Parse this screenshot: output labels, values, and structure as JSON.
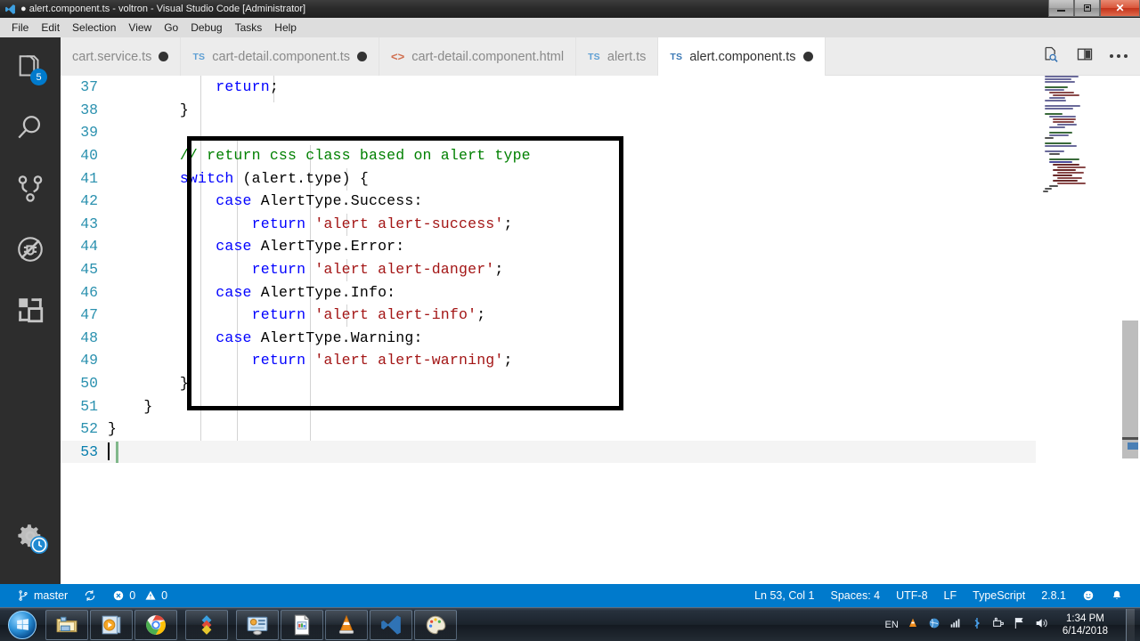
{
  "window": {
    "title": "● alert.component.ts - voltron - Visual Studio Code [Administrator]",
    "icon": "vscode-icon",
    "buttons": {
      "minimize": "minimize-button",
      "restore": "restore-button",
      "close": "close-button"
    }
  },
  "menubar": {
    "items": [
      "File",
      "Edit",
      "Selection",
      "View",
      "Go",
      "Debug",
      "Tasks",
      "Help"
    ]
  },
  "activitybar": {
    "items": [
      {
        "name": "explorer",
        "icon": "files-icon",
        "badge": "5"
      },
      {
        "name": "search",
        "icon": "search-icon",
        "badge": ""
      },
      {
        "name": "source-control",
        "icon": "source-control-icon",
        "badge": ""
      },
      {
        "name": "debug",
        "icon": "debug-no-icon",
        "badge": ""
      },
      {
        "name": "extensions",
        "icon": "extensions-icon",
        "badge": ""
      }
    ],
    "bottom": {
      "name": "manage",
      "icon": "gear-icon",
      "badge_icon": "clock-icon"
    }
  },
  "tabs": [
    {
      "label": "cart.service.ts",
      "icon": "",
      "dirty": true,
      "active": false
    },
    {
      "label": "cart-detail.component.ts",
      "icon": "TS",
      "dirty": true,
      "active": false
    },
    {
      "label": "cart-detail.component.html",
      "icon": "<>",
      "dirty": false,
      "active": false
    },
    {
      "label": "alert.ts",
      "icon": "TS",
      "dirty": false,
      "active": false
    },
    {
      "label": "alert.component.ts",
      "icon": "TS",
      "dirty": true,
      "active": true
    }
  ],
  "tab_actions": [
    {
      "name": "open-preview-icon"
    },
    {
      "name": "split-editor-icon"
    },
    {
      "name": "more-actions-icon"
    }
  ],
  "editor": {
    "first_line": 37,
    "lines": [
      {
        "num": 37,
        "tokens": [
          {
            "t": "            ",
            "c": ""
          },
          {
            "t": "return",
            "c": "ctl"
          },
          {
            "t": ";",
            "c": ""
          }
        ]
      },
      {
        "num": 38,
        "tokens": [
          {
            "t": "        }",
            "c": ""
          }
        ]
      },
      {
        "num": 39,
        "tokens": [
          {
            "t": "",
            "c": ""
          }
        ]
      },
      {
        "num": 40,
        "tokens": [
          {
            "t": "        // return css class based on alert type",
            "c": "cm"
          }
        ]
      },
      {
        "num": 41,
        "tokens": [
          {
            "t": "        ",
            "c": ""
          },
          {
            "t": "switch",
            "c": "ctl"
          },
          {
            "t": " (alert.type) {",
            "c": ""
          }
        ]
      },
      {
        "num": 42,
        "tokens": [
          {
            "t": "            ",
            "c": ""
          },
          {
            "t": "case",
            "c": "ctl"
          },
          {
            "t": " AlertType.Success:",
            "c": ""
          }
        ]
      },
      {
        "num": 43,
        "tokens": [
          {
            "t": "                ",
            "c": ""
          },
          {
            "t": "return",
            "c": "ctl"
          },
          {
            "t": " ",
            "c": ""
          },
          {
            "t": "'alert alert-success'",
            "c": "str"
          },
          {
            "t": ";",
            "c": ""
          }
        ]
      },
      {
        "num": 44,
        "tokens": [
          {
            "t": "            ",
            "c": ""
          },
          {
            "t": "case",
            "c": "ctl"
          },
          {
            "t": " AlertType.Error:",
            "c": ""
          }
        ]
      },
      {
        "num": 45,
        "tokens": [
          {
            "t": "                ",
            "c": ""
          },
          {
            "t": "return",
            "c": "ctl"
          },
          {
            "t": " ",
            "c": ""
          },
          {
            "t": "'alert alert-danger'",
            "c": "str"
          },
          {
            "t": ";",
            "c": ""
          }
        ]
      },
      {
        "num": 46,
        "tokens": [
          {
            "t": "            ",
            "c": ""
          },
          {
            "t": "case",
            "c": "ctl"
          },
          {
            "t": " AlertType.Info:",
            "c": ""
          }
        ]
      },
      {
        "num": 47,
        "tokens": [
          {
            "t": "                ",
            "c": ""
          },
          {
            "t": "return",
            "c": "ctl"
          },
          {
            "t": " ",
            "c": ""
          },
          {
            "t": "'alert alert-info'",
            "c": "str"
          },
          {
            "t": ";",
            "c": ""
          }
        ]
      },
      {
        "num": 48,
        "tokens": [
          {
            "t": "            ",
            "c": ""
          },
          {
            "t": "case",
            "c": "ctl"
          },
          {
            "t": " AlertType.Warning:",
            "c": ""
          }
        ]
      },
      {
        "num": 49,
        "tokens": [
          {
            "t": "                ",
            "c": ""
          },
          {
            "t": "return",
            "c": "ctl"
          },
          {
            "t": " ",
            "c": ""
          },
          {
            "t": "'alert alert-warning'",
            "c": "str"
          },
          {
            "t": ";",
            "c": ""
          }
        ]
      },
      {
        "num": 50,
        "tokens": [
          {
            "t": "        }",
            "c": ""
          }
        ]
      },
      {
        "num": 51,
        "tokens": [
          {
            "t": "    }",
            "c": ""
          }
        ]
      },
      {
        "num": 52,
        "tokens": [
          {
            "t": "}",
            "c": ""
          }
        ]
      },
      {
        "num": 53,
        "tokens": [
          {
            "t": "",
            "c": ""
          }
        ],
        "active": true,
        "git_added": true,
        "cursor": true
      }
    ],
    "annotation_box": {
      "name": "highlight-rectangle",
      "color": "#000000"
    }
  },
  "statusbar": {
    "branch": "master",
    "sync_icon": "sync-icon",
    "errors": "0",
    "warnings": "0",
    "position": "Ln 53, Col 1",
    "indentation": "Spaces: 4",
    "encoding": "UTF-8",
    "eol": "LF",
    "language": "TypeScript",
    "version": "2.8.1",
    "feedback_icon": "smiley-icon",
    "notifications_icon": "bell-icon",
    "accent": "#007acc"
  },
  "taskbar": {
    "start": "start-orb",
    "apps": [
      {
        "name": "file-explorer-icon"
      },
      {
        "name": "media-player-icon"
      },
      {
        "name": "chrome-icon"
      },
      {
        "name": "sublime-text-icon"
      },
      {
        "name": "control-panel-icon"
      },
      {
        "name": "document-icon"
      },
      {
        "name": "vlc-icon"
      },
      {
        "name": "vscode-icon"
      },
      {
        "name": "paint-icon"
      }
    ],
    "tray": {
      "language": "EN",
      "icons": [
        "vlc-tray-icon",
        "globe-icon",
        "network-icon",
        "bluetooth-icon",
        "safely-remove-icon",
        "flag-icon",
        "volume-icon"
      ],
      "time": "1:34 PM",
      "date": "6/14/2018"
    }
  }
}
